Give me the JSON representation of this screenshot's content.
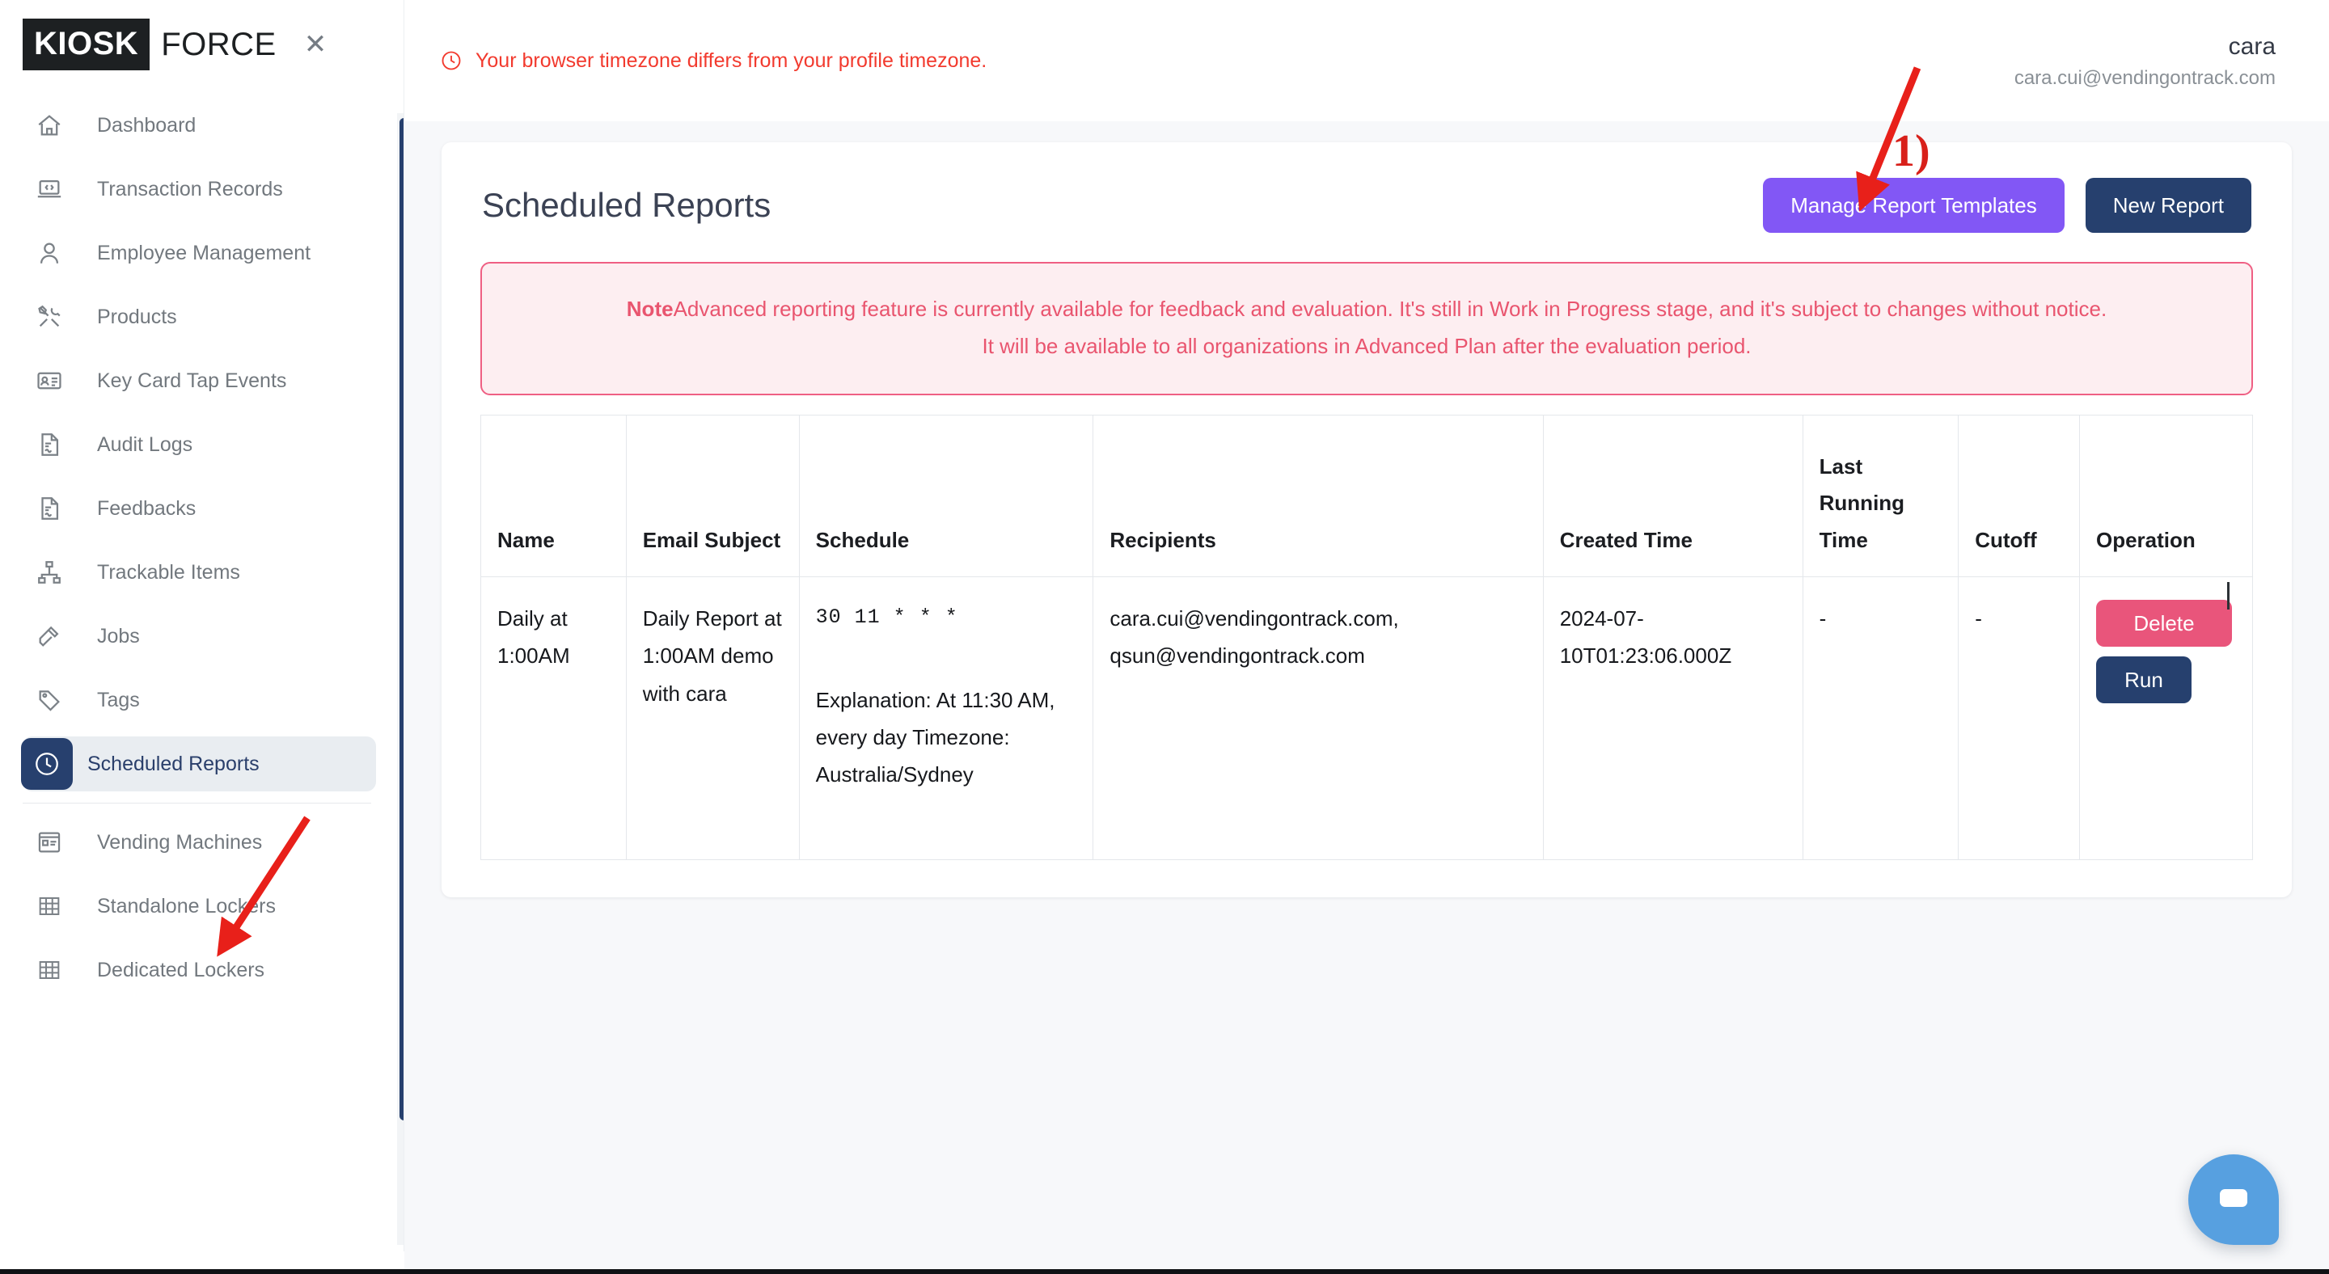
{
  "brand": {
    "logo_primary": "KIOSK",
    "logo_secondary": "FORCE",
    "close_icon": "close-icon"
  },
  "sidebar": {
    "items": [
      {
        "label": "Dashboard",
        "icon": "home-icon",
        "active": false
      },
      {
        "label": "Transaction Records",
        "icon": "laptop-code-icon",
        "active": false
      },
      {
        "label": "Employee Management",
        "icon": "user-icon",
        "active": false
      },
      {
        "label": "Products",
        "icon": "tools-icon",
        "active": false
      },
      {
        "label": "Key Card Tap Events",
        "icon": "id-card-icon",
        "active": false
      },
      {
        "label": "Audit Logs",
        "icon": "document-signature-icon",
        "active": false
      },
      {
        "label": "Feedbacks",
        "icon": "document-signature-icon",
        "active": false
      },
      {
        "label": "Trackable Items",
        "icon": "sitemap-icon",
        "active": false
      },
      {
        "label": "Jobs",
        "icon": "hammer-icon",
        "active": false
      },
      {
        "label": "Tags",
        "icon": "tag-icon",
        "active": false
      },
      {
        "label": "Scheduled Reports",
        "icon": "clock-icon",
        "active": true
      }
    ],
    "items_secondary": [
      {
        "label": "Vending Machines",
        "icon": "vending-machine-icon"
      },
      {
        "label": "Standalone Lockers",
        "icon": "grid-icon"
      },
      {
        "label": "Dedicated Lockers",
        "icon": "grid-icon"
      }
    ],
    "scrollbar_color": "#27406e"
  },
  "topbar": {
    "timezone_warning": "Your browser timezone differs from your profile timezone.",
    "timezone_warning_icon": "clock-alert-icon",
    "warning_color": "#f23a2e",
    "user": {
      "name": "cara",
      "email": "cara.cui@vendingontrack.com"
    }
  },
  "page": {
    "title": "Scheduled Reports",
    "buttons": {
      "manage_templates": "Manage Report Templates",
      "manage_templates_color": "#8257f5",
      "new_report": "New Report",
      "new_report_color": "#26406e"
    },
    "note": {
      "label": "Note",
      "line1": "Advanced reporting feature is currently available for feedback and evaluation. It's still in Work in Progress stage, and it's subject to changes without notice.",
      "line2": "It will be available to all organizations in Advanced Plan after the evaluation period.",
      "text_color": "#e9556f",
      "bg_color": "#fdeef1",
      "border_color": "#ef5f83"
    }
  },
  "table": {
    "headers": [
      "Name",
      "Email Subject",
      "Schedule",
      "Recipients",
      "Created Time",
      "Last Running Time",
      "Cutoff",
      "Operation"
    ],
    "rows": [
      {
        "name": "Daily at 1:00AM",
        "email_subject": "Daily Report at 1:00AM demo with cara",
        "schedule_cron": "30 11 * * *",
        "schedule_explanation": "Explanation: At 11:30 AM, every day Timezone: Australia/Sydney",
        "recipients": "cara.cui@vendingontrack.com, qsun@vendingontrack.com",
        "created_time": "2024-07-10T01:23:06.000Z",
        "last_running_time": "-",
        "cutoff": "-",
        "operations": {
          "delete": "Delete",
          "delete_color": "#e9557b",
          "run": "Run",
          "run_color": "#26406e"
        }
      }
    ]
  },
  "chat": {
    "icon": "chat-bubble-icon",
    "color": "#57a0e0"
  },
  "annotations": {
    "step_one_label": "1)",
    "arrow_color": "#e8201a"
  }
}
